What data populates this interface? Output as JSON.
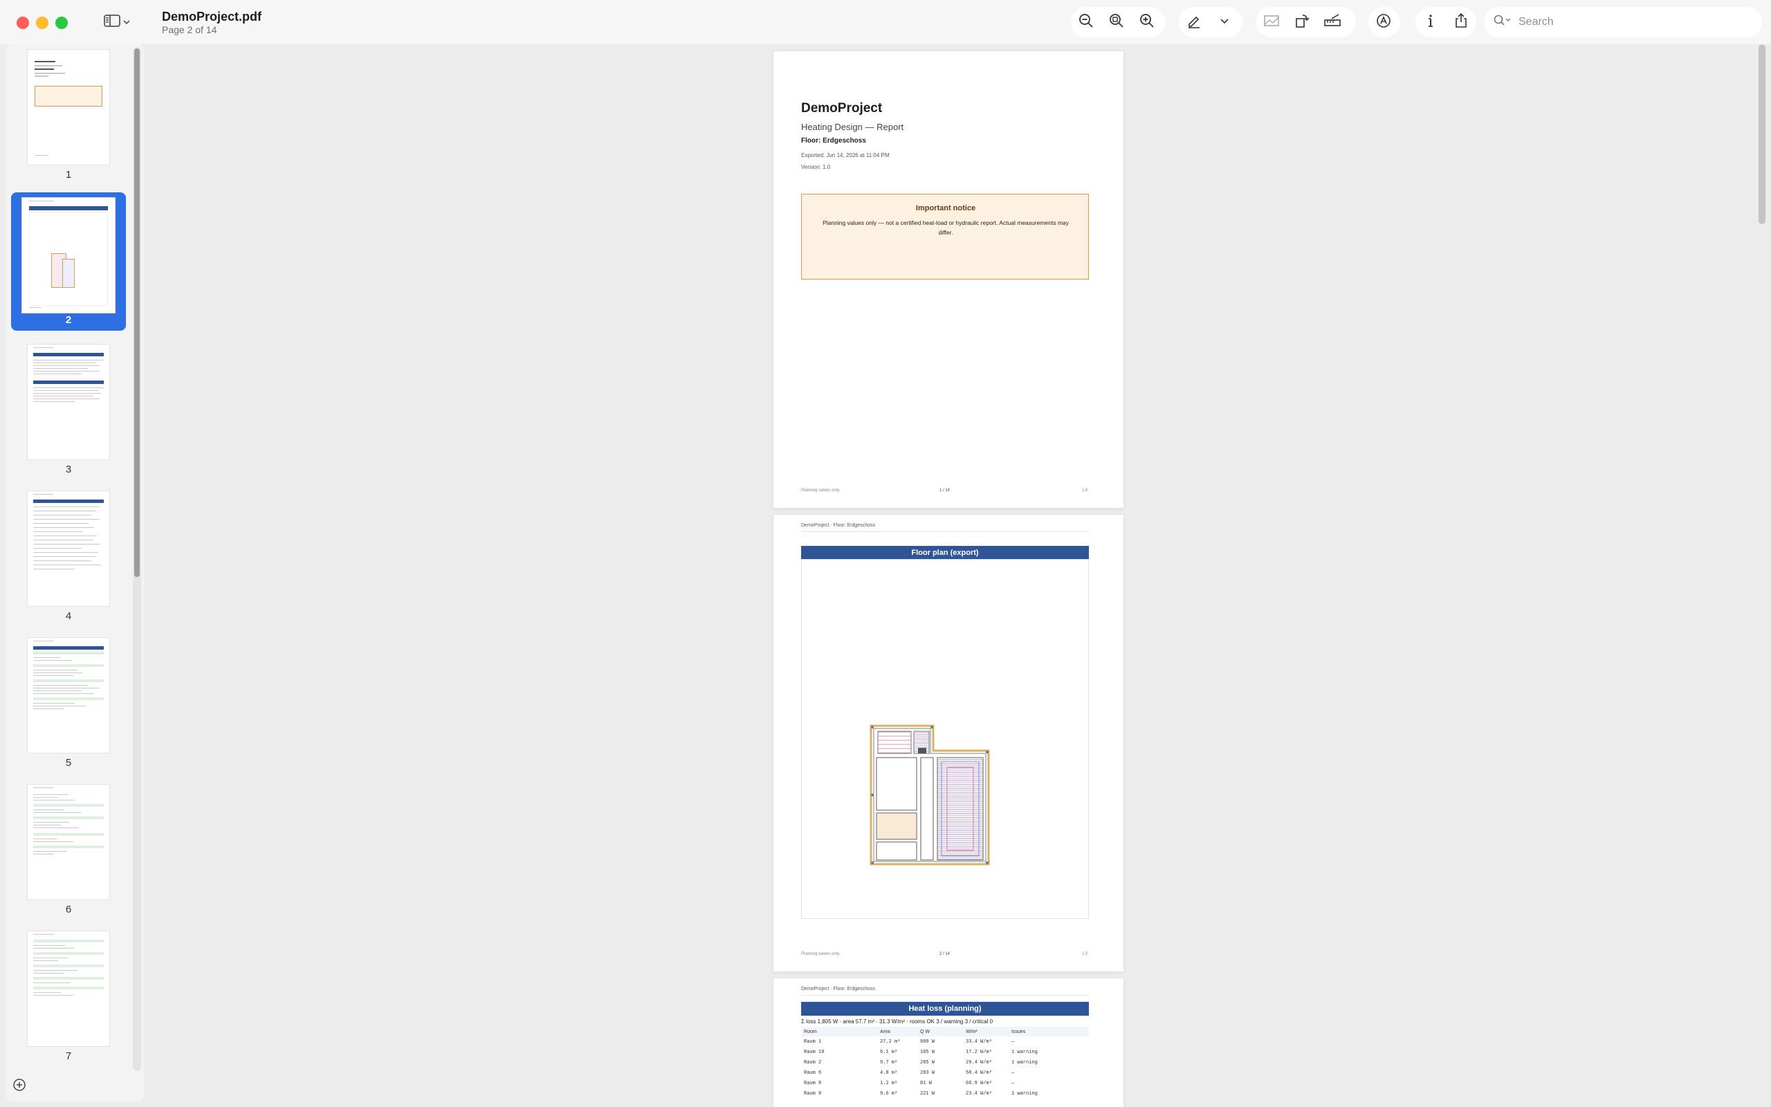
{
  "window": {
    "title": "DemoProject.pdf",
    "subtitle": "Page 2 of 14"
  },
  "toolbar": {
    "search_placeholder": "Search",
    "icons": [
      "zoom-out-icon",
      "actual-size-icon",
      "zoom-in-icon",
      "highlight-pen-icon",
      "chevron-down-icon",
      "image-view-icon",
      "rotate-icon",
      "markup-icon",
      "annotate-icon",
      "info-icon",
      "share-icon",
      "search-icon"
    ]
  },
  "sidebar": {
    "selected_page": "2",
    "thumbnails": [
      {
        "label": "1"
      },
      {
        "label": "2"
      },
      {
        "label": "3"
      },
      {
        "label": "4"
      },
      {
        "label": "5"
      },
      {
        "label": "6"
      },
      {
        "label": "7"
      }
    ]
  },
  "page1": {
    "title": "DemoProject",
    "subtitle": "Heating Design — Report",
    "floor": "Floor: Erdgeschoss",
    "exported": "Exported: Jun 14, 2026 at 11:04 PM",
    "version": "Version: 1.0",
    "notice_title": "Important notice",
    "notice_body": "Planning values only — not a certified heat-load or hydraulic report. Actual measurements may differ.",
    "footer_left": "Planning values only.",
    "footer_center": "1 / 14",
    "footer_right": "1.0"
  },
  "page2": {
    "header": "DemoProject · Floor: Erdgeschoss",
    "section_title": "Floor plan (export)",
    "footer_left": "Planning values only.",
    "footer_center": "2 / 14",
    "footer_right": "1.0"
  },
  "page3": {
    "header": "DemoProject · Floor: Erdgeschoss",
    "section_title": "Heat loss (planning)",
    "summary": "Σ loss 1,805 W · area 57.7 m² · 31.3 W/m² · rooms OK 3 / warning 3 / critical 0",
    "columns": [
      "Room",
      "Area",
      "Q W",
      "W/m²",
      "Issues"
    ],
    "rows": [
      [
        "Raum 1",
        "27.2 m²",
        "909 W",
        "33.4 W/m²",
        "—"
      ],
      [
        "Raum 10",
        "6.1 m²",
        "105 W",
        "17.2 W/m²",
        "1 warning"
      ],
      [
        "Raum 2",
        "9.7 m²",
        "285 W",
        "29.4 W/m²",
        "1 warning"
      ],
      [
        "Raum 6",
        "4.8 m²",
        "283 W",
        "58.4 W/m²",
        "—"
      ],
      [
        "Raum 8",
        "1.2 m²",
        "81 W",
        "66.9 W/m²",
        "—"
      ],
      [
        "Raum 9",
        "9.6 m²",
        "221 W",
        "23.4 W/m²",
        "1 warning"
      ]
    ]
  }
}
